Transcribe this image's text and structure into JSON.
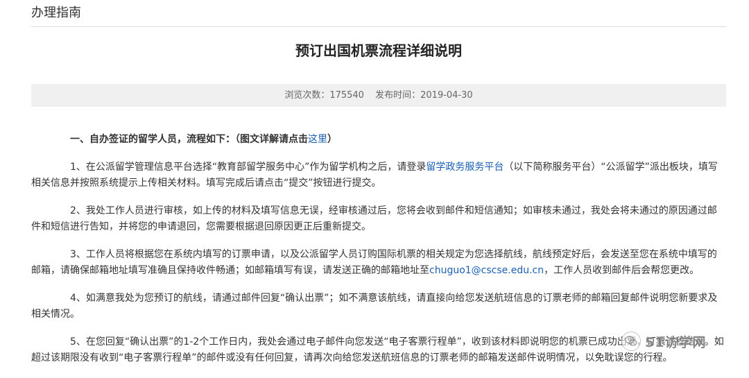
{
  "section": {
    "title": "办理指南"
  },
  "article": {
    "title": "预订出国机票流程详细说明",
    "views_label": "浏览次数：",
    "views_value": "175540",
    "date_label": "发布时间：",
    "date_value": "2019-04-30"
  },
  "content": {
    "heading_text": "一、自办签证的留学人员，流程如下：（图文详解请点击",
    "heading_link": "这里",
    "heading_close": "）",
    "p1_a": "1、在公派留学管理信息平台选择“教育部留学服务中心”作为留学机构之后，请登录",
    "p1_link": "留学政务服务平台",
    "p1_b": "（以下简称服务平台）“公派留学”派出板块，填写相关信息并按照系统提示上传相关材料。填写完成后请点击“提交”按钮进行提交。",
    "p2": "2、我处工作人员进行审核，如上传的材料及填写信息无误，经审核通过后，您将会收到邮件和短信通知；如审核未通过，我处会将未通过的原因通过邮件和短信进行告知，并将您的申请退回，您需要根据退回原因更正后重新提交。",
    "p3_a": "3、工作人员将根据您在系统内填写的订票申请，以及公派留学人员订购国际机票的相关规定为您选择航线，航线预定好后，会发送至您在系统中填写的邮箱，请确保邮箱地址填写准确且保持收件畅通；如邮箱填写有误，请发送正确的邮箱地址至",
    "p3_email": "chuguo1@cscse.edu.cn",
    "p3_b": "，工作人员收到邮件后会帮您更改。",
    "p4": "4、如满意我处为您预订的航线，请通过邮件回复“确认出票”；如不满意该航线，请直接向给您发送航班信息的订票老师的邮箱回复邮件说明您新要求及相关情况。",
    "p5": "5、在您回复“确认出票”的1-2个工作日内，我处会通过电子邮件向您发送“电子客票行程单”，收到该材料即说明您的机票已成功出票，订票流程结束。如超过该期限没有收到“电子客票行程单”的邮件或没有任何回复，请再次向给您发送航班信息的订票老师的邮箱发送邮件说明情况，以免耽误您的行程。"
  },
  "watermark": {
    "text": "51访学网",
    "icon": "wechat-logo-icon"
  },
  "colors": {
    "link": "#1a5fb4",
    "meta_bg": "#f0f0f0",
    "divider": "#dcdcdc"
  }
}
